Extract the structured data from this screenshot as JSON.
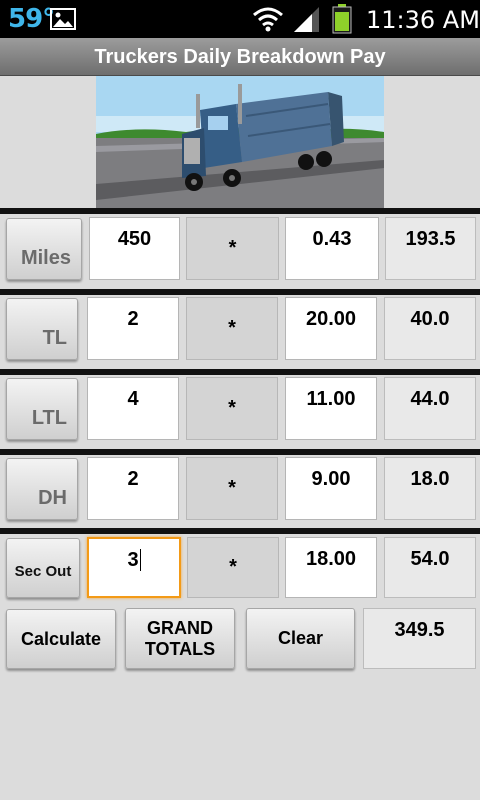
{
  "status_bar": {
    "temperature": "59°",
    "time": "11:36 AM",
    "icons": [
      "gallery-icon",
      "wifi-icon",
      "signal-icon",
      "battery-icon"
    ]
  },
  "app": {
    "title": "Truckers Daily Breakdown Pay",
    "header_color": "#7f7f7f"
  },
  "rows": [
    {
      "label": "Miles",
      "quantity": "450",
      "operator": "*",
      "rate": "0.43",
      "result": "193.5"
    },
    {
      "label": "TL",
      "quantity": "2",
      "operator": "*",
      "rate": "20.00",
      "result": "40.0"
    },
    {
      "label": "LTL",
      "quantity": "4",
      "operator": "*",
      "rate": "11.00",
      "result": "44.0"
    },
    {
      "label": "DH",
      "quantity": "2",
      "operator": "*",
      "rate": "9.00",
      "result": "18.0"
    },
    {
      "label": "Sec Out",
      "quantity": "3",
      "operator": "*",
      "rate": "18.00",
      "result": "54.0"
    }
  ],
  "actions": {
    "calculate_label": "Calculate",
    "grand_totals_line1": "GRAND",
    "grand_totals_line2": "TOTALS",
    "clear_label": "Clear",
    "grand_total_value": "349.5"
  },
  "colors": {
    "focus_border": "#f39a16",
    "divider": "#111111",
    "background": "#dcdcdc"
  }
}
